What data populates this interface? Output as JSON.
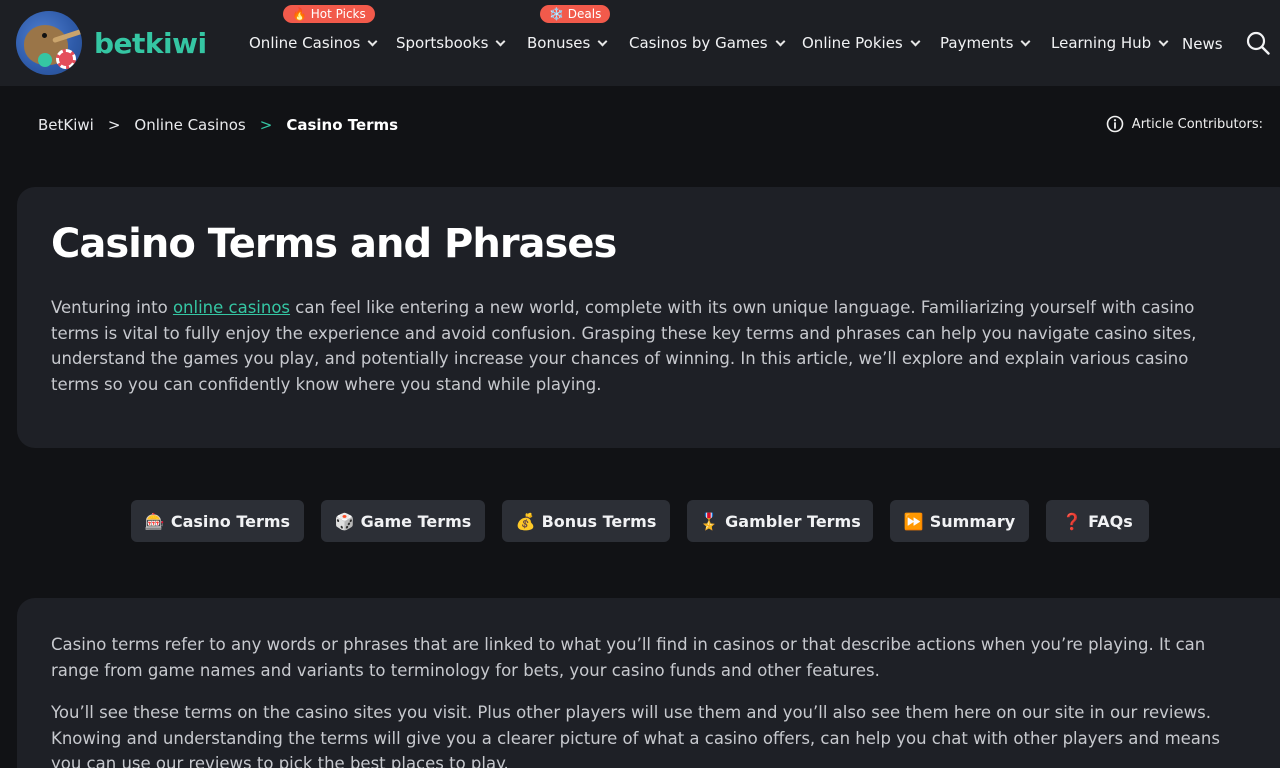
{
  "header": {
    "logo_text": "betkiwi",
    "nav": [
      {
        "label": "Online Casinos",
        "badge": "🔥 Hot Picks"
      },
      {
        "label": "Sportsbooks"
      },
      {
        "label": "Bonuses",
        "badge": "❄️ Deals"
      },
      {
        "label": "Casinos by Games"
      },
      {
        "label": "Online Pokies"
      },
      {
        "label": "Payments"
      },
      {
        "label": "Learning Hub"
      },
      {
        "label": "News"
      }
    ]
  },
  "breadcrumb": {
    "items": [
      "BetKiwi",
      "Online Casinos",
      "Casino Terms"
    ],
    "separator": ">"
  },
  "contributors_label": "Article Contributors:",
  "hero": {
    "title": "Casino Terms and Phrases",
    "intro_before": "Venturing into ",
    "intro_link": "online casinos",
    "intro_after": " can feel like entering a new world, complete with its own unique language. Familiarizing yourself with casino terms is vital to fully enjoy the experience and avoid confusion. Grasping these key terms and phrases can help you navigate casino sites, understand the games you play, and potentially increase your chances of winning. In this article, we’ll explore and explain various casino terms so you can confidently know where you stand while playing."
  },
  "pills": [
    {
      "emoji": "🎰",
      "label": "Casino Terms"
    },
    {
      "emoji": "🎲",
      "label": "Game Terms"
    },
    {
      "emoji": "💰",
      "label": "Bonus Terms"
    },
    {
      "emoji": "🎖️",
      "label": "Gambler Terms"
    },
    {
      "emoji": "⏩",
      "label": "Summary"
    },
    {
      "emoji": "❓",
      "label": "FAQs"
    }
  ],
  "body": {
    "paragraphs": [
      "Casino terms refer to any words or phrases that are linked to what you’ll find in casinos or that describe actions when you’re playing. It can range from game names and variants to terminology for bets, your casino funds and other features.",
      "You’ll see these terms on the casino sites you visit. Plus other players will use them and you’ll also see them here on our site in our reviews. Knowing and understanding the terms will give you a clearer picture of what a casino offers, can help you chat with other players and means you can use our reviews to pick the best places to play."
    ]
  },
  "colors": {
    "accent": "#35c6a3",
    "badge": "#f25a4b",
    "header_bg": "#1d1f24",
    "page_bg": "#111215",
    "card_bg": "#1e2026"
  }
}
